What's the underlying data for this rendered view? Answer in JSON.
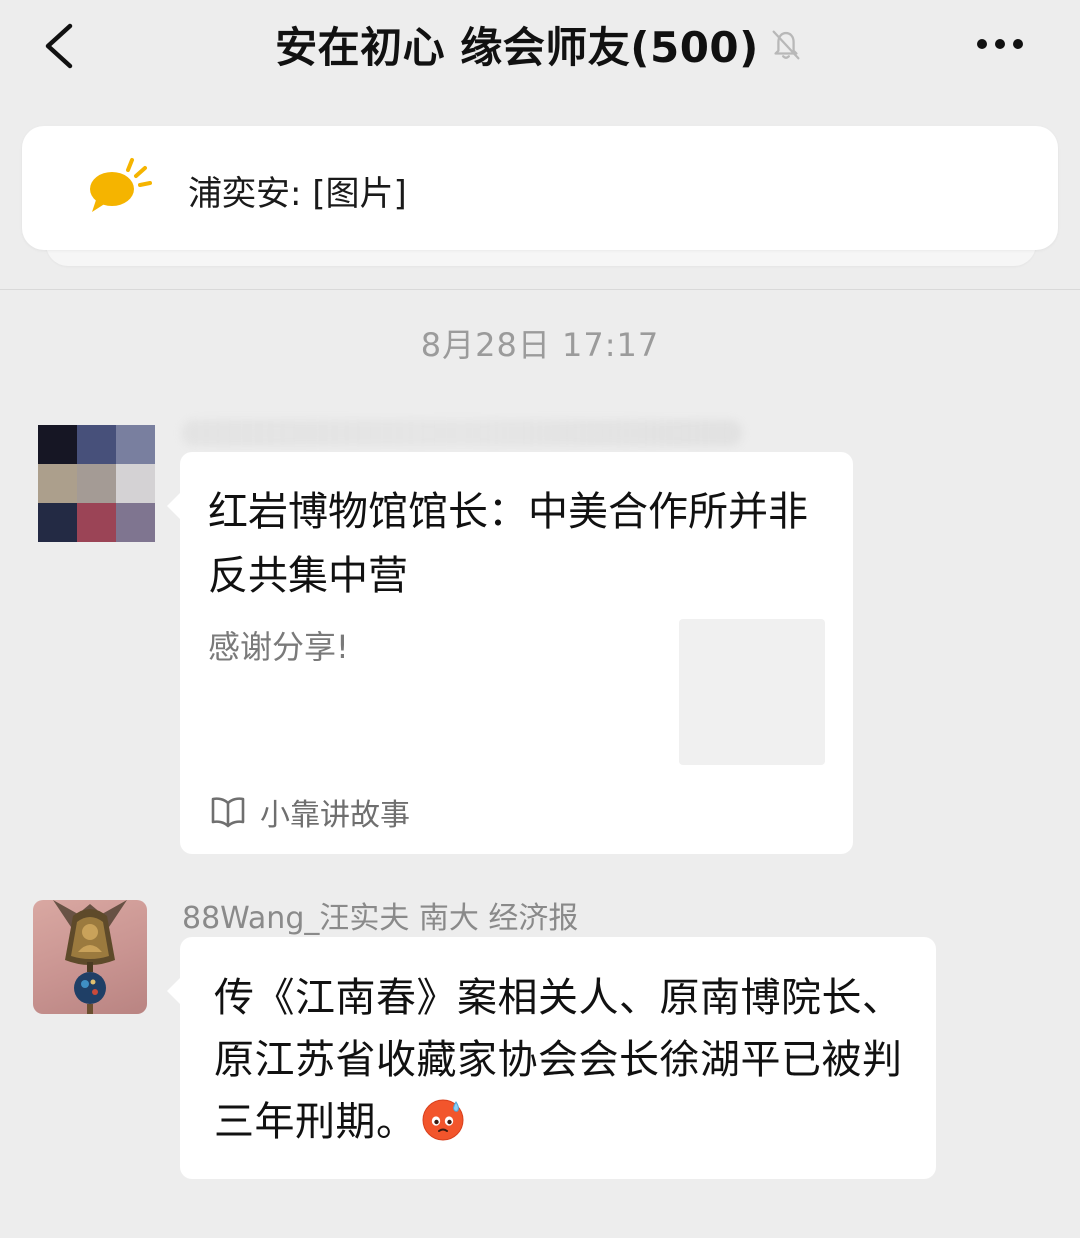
{
  "header": {
    "title": "安在初心 缘会师友(500)",
    "back_icon": "chevron-left-icon",
    "mute_icon": "bell-off-icon",
    "more_icon": "more-dots-icon"
  },
  "pinned": {
    "icon": "speech-bubble-icon",
    "text": "浦奕安: [图片]",
    "icon_color": "#f5b400"
  },
  "timestamp": "8月28日 17:17",
  "messages": [
    {
      "sender": "",
      "avatar_icon": "pixelated-avatar",
      "type": "link-card",
      "card": {
        "title": "红岩博物馆馆长：中美合作所并非反共集中营",
        "description": "感谢分享!",
        "source_icon": "book-open-icon",
        "source": "小靠讲故事"
      }
    },
    {
      "sender": "88Wang_汪实夫 南大 经济报",
      "avatar_icon": "buddha-pendant-avatar",
      "type": "text",
      "text": "传《江南春》案相关人、原南博院长、原江苏省收藏家协会会长徐湖平已被判三年刑期。",
      "emoji": "sweat-face-emoji"
    }
  ],
  "colors": {
    "background": "#ededed",
    "bubble": "#ffffff",
    "secondary_text": "#8a8a8a"
  }
}
